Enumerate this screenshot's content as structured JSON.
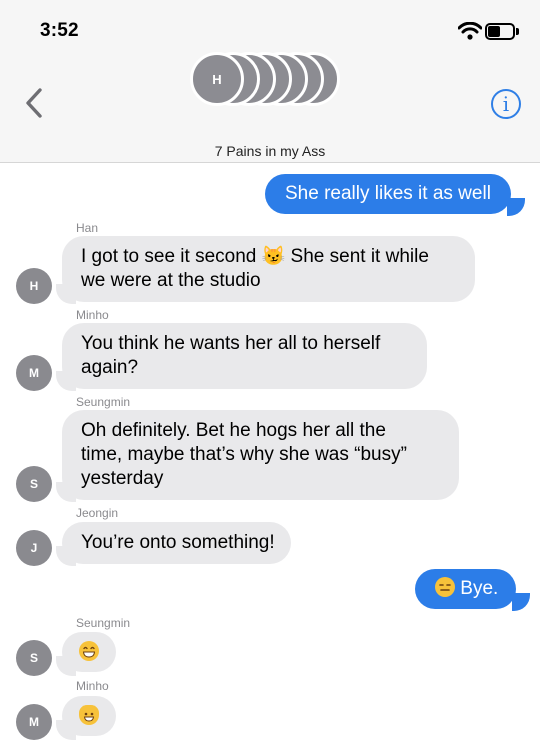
{
  "status_bar": {
    "time": "3:52"
  },
  "header": {
    "avatar_initial": "H",
    "group_name": "7 Pains in my Ass"
  },
  "messages": [
    {
      "sender": "",
      "avatar": "",
      "text": "She really likes it as well"
    },
    {
      "sender": "Han",
      "avatar": "H",
      "lines": [
        "I got to see it second 😼 She sent it while",
        "we were at the studio"
      ]
    },
    {
      "sender": "Minho",
      "avatar": "M",
      "lines": [
        "You think he wants her all to herself",
        "again?"
      ]
    },
    {
      "sender": "Seungmin",
      "avatar": "S",
      "lines": [
        "Oh definitely. Bet he hogs her all the",
        "time, maybe that’s why she was “busy”",
        "yesterday"
      ]
    },
    {
      "sender": "Jeongin",
      "avatar": "J",
      "text": "You’re onto something!"
    },
    {
      "sender": "",
      "avatar": "",
      "text": "Bye."
    },
    {
      "sender": "Seungmin",
      "avatar": "S",
      "emoji": "grinning-face"
    },
    {
      "sender": "Minho",
      "avatar": "M",
      "emoji": "grinning-cat-face"
    }
  ]
}
